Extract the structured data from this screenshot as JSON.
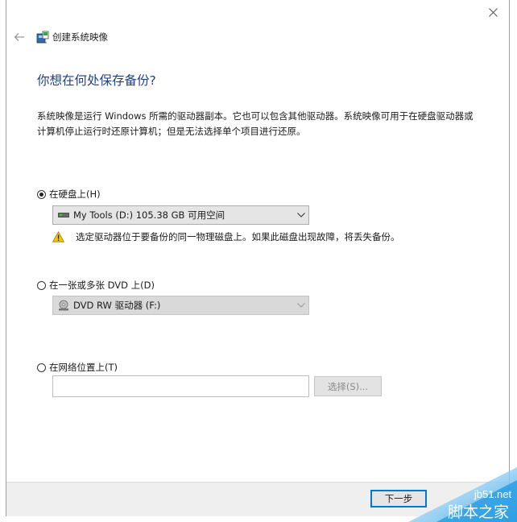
{
  "window": {
    "title": "创建系统映像"
  },
  "heading": "你想在何处保存备份?",
  "description": "系统映像是运行 Windows 所需的驱动器副本。它也可以包含其他驱动器。系统映像可用于在硬盘驱动器或计算机停止运行时还原计算机；但是无法选择单个项目进行还原。",
  "options": {
    "hard_disk": {
      "label": "在硬盘上(H)",
      "selected": true,
      "drive": "My Tools (D:)  105.38 GB 可用空间",
      "warning": "选定驱动器位于要备份的同一物理磁盘上。如果此磁盘出现故障，将丢失备份。"
    },
    "dvd": {
      "label": "在一张或多张 DVD 上(D)",
      "selected": false,
      "drive": "DVD RW 驱动器 (F:)"
    },
    "network": {
      "label": "在网络位置上(T)",
      "selected": false,
      "path_value": "",
      "browse_label": "选择(S)..."
    }
  },
  "footer": {
    "next_label": "下一步"
  },
  "watermark": {
    "line1": "jb51.net",
    "line2": "脚本之家"
  },
  "icons": {
    "close": "close-icon",
    "back": "back-arrow-icon",
    "app": "system-image-backup-icon",
    "hdd": "hard-drive-icon",
    "dvd": "dvd-drive-icon",
    "warning": "warning-icon",
    "dropdown": "chevron-down-icon"
  },
  "colors": {
    "heading": "#1f3f8a",
    "accent": "#0078d7",
    "warning": "#f2c500"
  }
}
